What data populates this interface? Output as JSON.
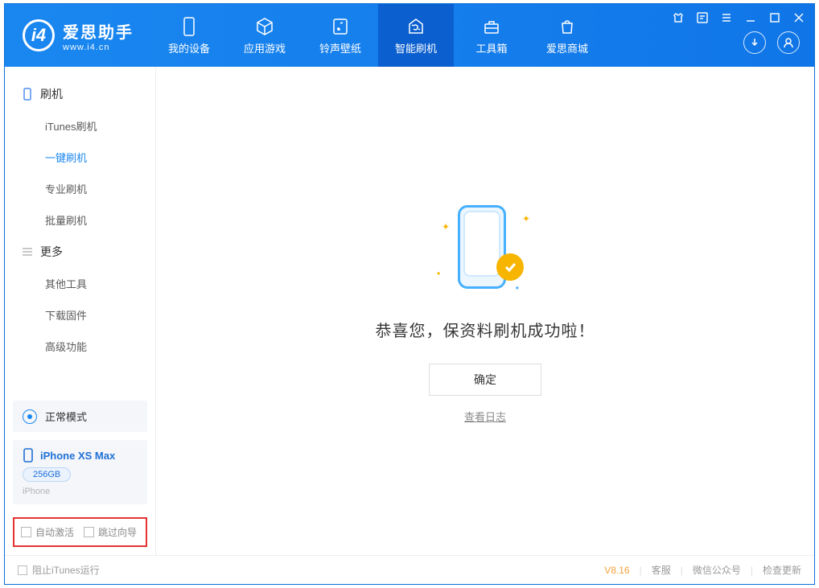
{
  "app": {
    "name": "爱思助手",
    "url": "www.i4.cn"
  },
  "top_tabs": [
    {
      "label": "我的设备",
      "icon": "device-icon"
    },
    {
      "label": "应用游戏",
      "icon": "cube-icon"
    },
    {
      "label": "铃声壁纸",
      "icon": "music-icon"
    },
    {
      "label": "智能刷机",
      "icon": "refresh-icon",
      "active": true
    },
    {
      "label": "工具箱",
      "icon": "toolbox-icon"
    },
    {
      "label": "爱思商城",
      "icon": "store-icon"
    }
  ],
  "sidebar": {
    "group1": {
      "title": "刷机",
      "items": [
        "iTunes刷机",
        "一键刷机",
        "专业刷机",
        "批量刷机"
      ],
      "active_index": 1
    },
    "group2": {
      "title": "更多",
      "items": [
        "其他工具",
        "下载固件",
        "高级功能"
      ]
    },
    "status": "正常模式",
    "device": {
      "name": "iPhone XS Max",
      "storage": "256GB",
      "type": "iPhone"
    },
    "checks": {
      "auto_activate": "自动激活",
      "skip_guide": "跳过向导"
    }
  },
  "main": {
    "success_message": "恭喜您，保资料刷机成功啦！",
    "ok_button": "确定",
    "view_log": "查看日志"
  },
  "footer": {
    "stop_itunes": "阻止iTunes运行",
    "version": "V8.16",
    "links": [
      "客服",
      "微信公众号",
      "检查更新"
    ]
  }
}
